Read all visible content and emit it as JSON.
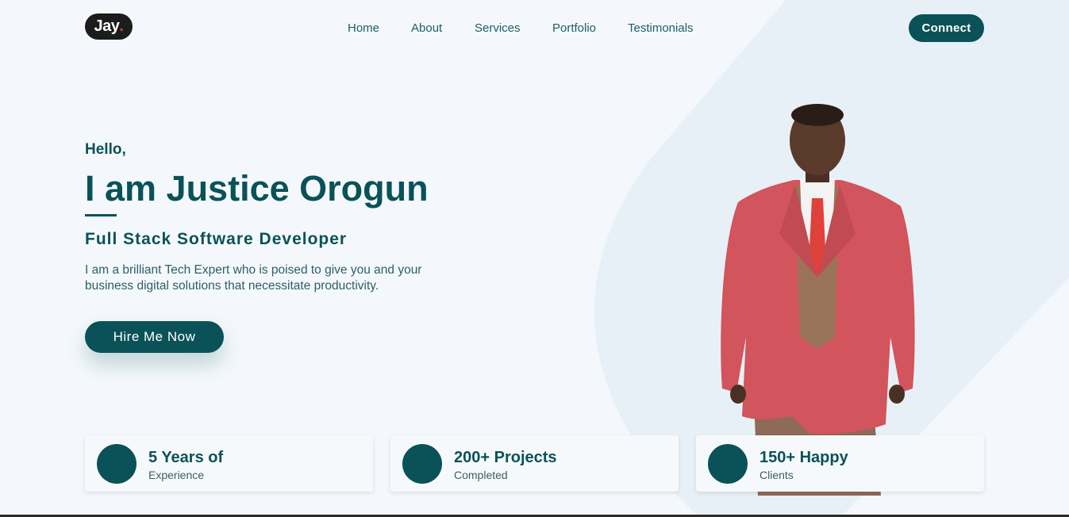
{
  "header": {
    "logo_text": "Jay",
    "logo_dot": ".",
    "nav": [
      {
        "label": "Home"
      },
      {
        "label": "About"
      },
      {
        "label": "Services"
      },
      {
        "label": "Portfolio"
      },
      {
        "label": "Testimonials"
      }
    ],
    "connect_label": "Connect"
  },
  "hero": {
    "greeting": "Hello,",
    "name": "I am Justice Orogun",
    "role": "Full Stack Software Developer",
    "intro": "I am a brilliant Tech Expert who is poised to give you and your business digital solutions that necessitate productivity.",
    "cta_label": "Hire Me Now"
  },
  "stats": [
    {
      "title": "5 Years of",
      "subtitle": "Experience"
    },
    {
      "title": "200+ Projects",
      "subtitle": "Completed"
    },
    {
      "title": "150+ Happy",
      "subtitle": "Clients"
    }
  ],
  "colors": {
    "primary": "#0a5257",
    "background": "#f4f8fc",
    "logo_bg": "#1c1c1c",
    "blazer": "#d2545c"
  }
}
